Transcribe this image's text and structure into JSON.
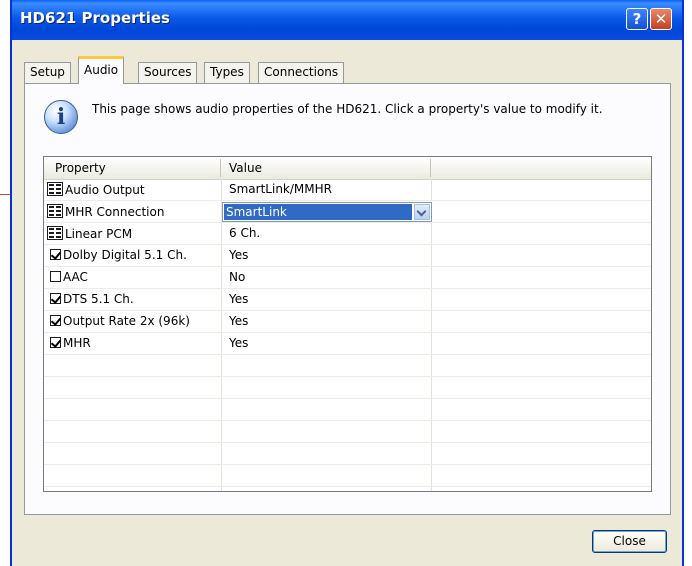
{
  "window": {
    "title": "HD621 Properties",
    "help_button": "?",
    "close_glyph": "✕"
  },
  "tabs": [
    {
      "label": "Setup",
      "active": false
    },
    {
      "label": "Audio",
      "active": true
    },
    {
      "label": "Sources",
      "active": false
    },
    {
      "label": "Types",
      "active": false
    },
    {
      "label": "Connections",
      "active": false
    }
  ],
  "info": {
    "icon": "info-icon",
    "glyph": "i",
    "text": "This page shows audio properties of the HD621. Click a property's value to modify it."
  },
  "grid": {
    "columns": [
      "Property",
      "Value"
    ],
    "rows": [
      {
        "kind": "list",
        "name": "Audio Output",
        "value": "SmartLink/MMHR"
      },
      {
        "kind": "list",
        "name": "MHR Connection",
        "value": "SmartLink",
        "editing": true
      },
      {
        "kind": "list",
        "name": "Linear PCM",
        "value": "6 Ch."
      },
      {
        "kind": "check",
        "checked": true,
        "name": "Dolby Digital 5.1 Ch.",
        "value": "Yes"
      },
      {
        "kind": "check",
        "checked": false,
        "name": "AAC",
        "value": "No"
      },
      {
        "kind": "check",
        "checked": true,
        "name": "DTS 5.1 Ch.",
        "value": "Yes"
      },
      {
        "kind": "check",
        "checked": true,
        "name": "Output Rate 2x (96k)",
        "value": "Yes"
      },
      {
        "kind": "check",
        "checked": true,
        "name": "MHR",
        "value": "Yes"
      }
    ]
  },
  "buttons": {
    "close_label": "Close"
  },
  "colors": {
    "titlebar": "#0a58e8",
    "selection": "#316ac5",
    "tab_highlight": "#ffc83c",
    "dialog_bg": "#ece9d8"
  }
}
